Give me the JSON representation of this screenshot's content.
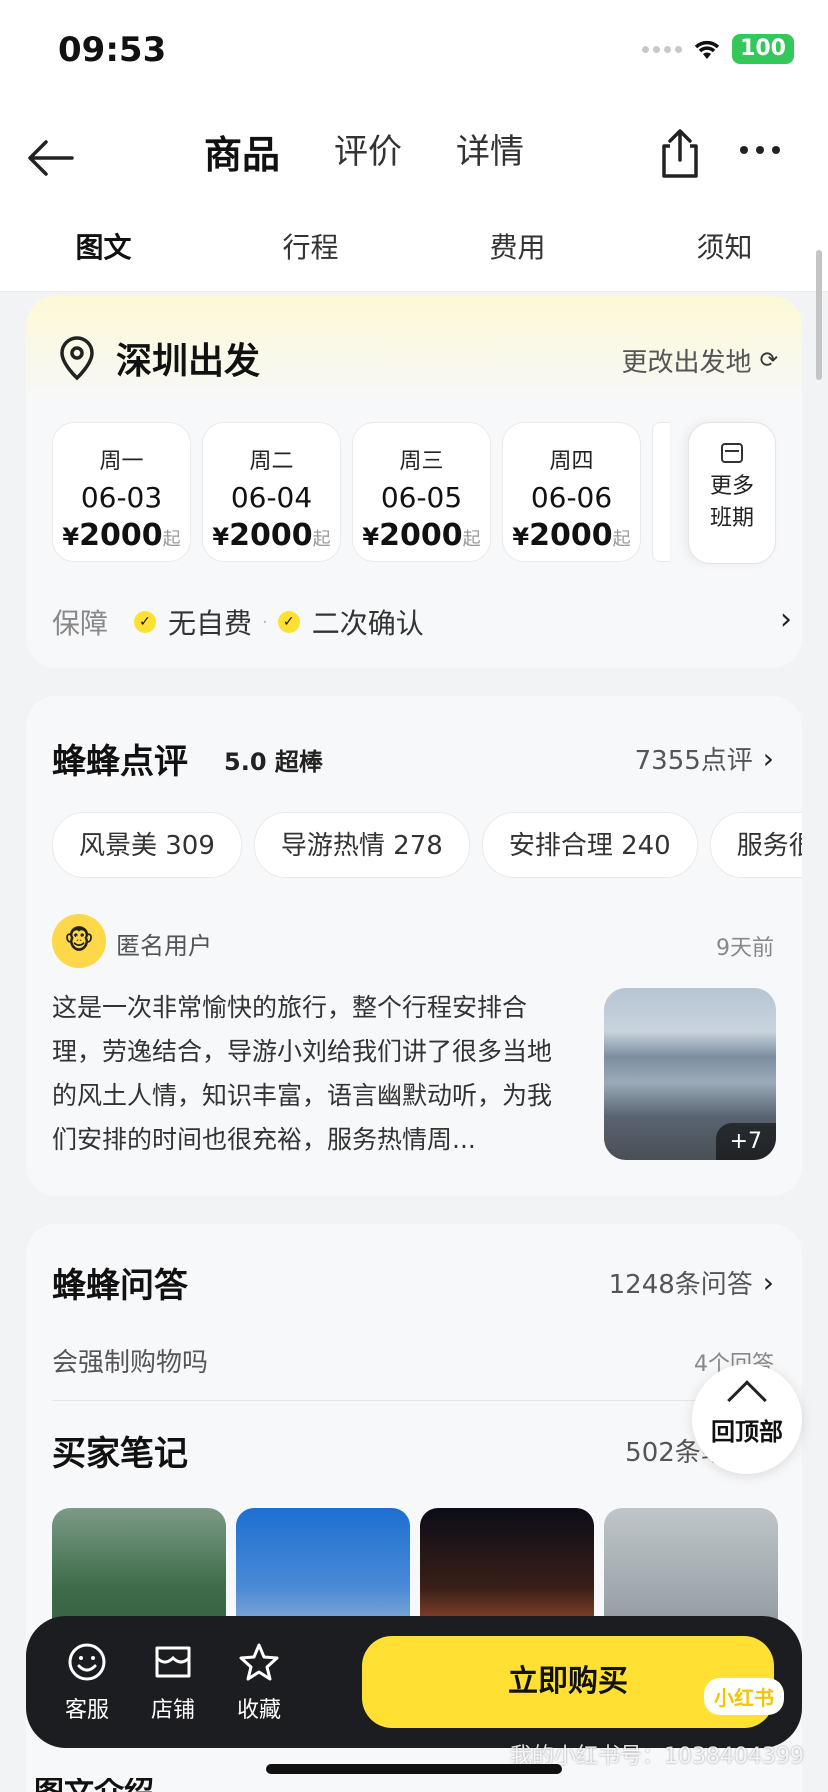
{
  "status_bar": {
    "time": "09:53",
    "battery": "100"
  },
  "nav": {
    "tabs": [
      {
        "label": "商品"
      },
      {
        "label": "评价"
      },
      {
        "label": "详情"
      }
    ],
    "sub_tabs": [
      {
        "label": "图文"
      },
      {
        "label": "行程"
      },
      {
        "label": "费用"
      },
      {
        "label": "须知"
      }
    ]
  },
  "departure": {
    "title": "深圳出发",
    "change_label": "更改出发地",
    "dates": [
      {
        "week": "周一",
        "date": "06-03",
        "currency": "¥",
        "price": "2000",
        "suffix": "起"
      },
      {
        "week": "周二",
        "date": "06-04",
        "currency": "¥",
        "price": "2000",
        "suffix": "起"
      },
      {
        "week": "周三",
        "date": "06-05",
        "currency": "¥",
        "price": "2000",
        "suffix": "起"
      },
      {
        "week": "周四",
        "date": "06-06",
        "currency": "¥",
        "price": "2000",
        "suffix": "起"
      }
    ],
    "more_dates_label": "更多班期",
    "guarantee": {
      "label": "保障",
      "items": [
        "无自费",
        "二次确认"
      ]
    }
  },
  "reviews": {
    "title": "蜂蜂点评",
    "score": "5.0 超棒",
    "count_label": "7355点评",
    "tags": [
      "风景美 309",
      "导游热情 278",
      "安排合理 240",
      "服务很"
    ],
    "item": {
      "user": "匿名用户",
      "time": "9天前",
      "text": "这是一次非常愉快的旅行，整个行程安排合理，劳逸结合，导游小刘给我们讲了很多当地的风土人情，知识丰富，语言幽默动听，为我们安排的时间也很充裕，服务热情周...",
      "photo_count": "+7"
    }
  },
  "qa": {
    "title": "蜂蜂问答",
    "count_label": "1248条问答",
    "question": "会强制购物吗",
    "answers": "4个回答"
  },
  "notes": {
    "title": "买家笔记",
    "count_label": "502条笔记"
  },
  "back_to_top": "回顶部",
  "bottom_bar": {
    "service": "客服",
    "shop": "店铺",
    "favorite": "收藏",
    "buy": "立即购买",
    "badge": "小红书"
  },
  "watermark": "我的小红书号：1038404399",
  "peek_heading": "图文介绍"
}
